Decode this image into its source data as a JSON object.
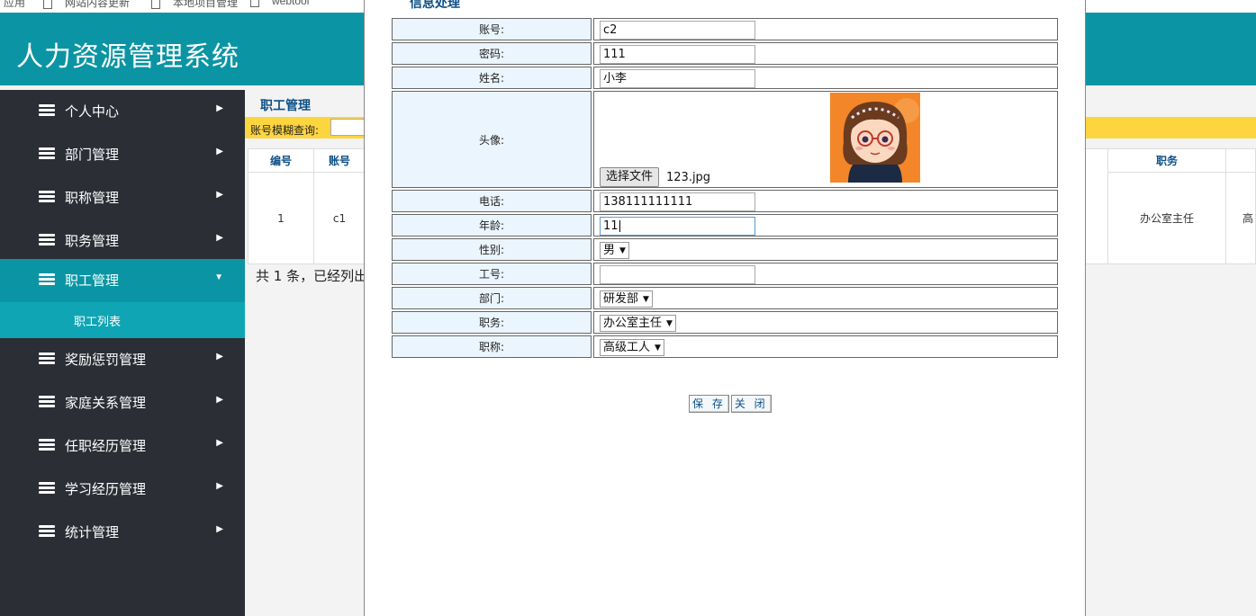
{
  "bookmarks": [
    "应用",
    "网站内容更新",
    "本地项目管理",
    "webtool"
  ],
  "app": {
    "title": "人力资源管理系统"
  },
  "sidebar": {
    "items": [
      {
        "label": "个人中心"
      },
      {
        "label": "部门管理"
      },
      {
        "label": "职称管理"
      },
      {
        "label": "职务管理"
      },
      {
        "label": "职工管理"
      },
      {
        "label": "奖励惩罚管理"
      },
      {
        "label": "家庭关系管理"
      },
      {
        "label": "任职经历管理"
      },
      {
        "label": "学习经历管理"
      },
      {
        "label": "统计管理"
      }
    ],
    "active_sub": "职工列表",
    "arrow_right": "▶",
    "arrow_down": "▼"
  },
  "main": {
    "title": "职工管理",
    "search_label": "账号模糊查询:",
    "table": {
      "headers": [
        "编号",
        "账号",
        "职务"
      ],
      "row": [
        "1",
        "c1",
        "办公室主任",
        "高"
      ]
    },
    "count_text": "共 1 条，已经列出"
  },
  "modal": {
    "title": "信息处理",
    "fields": {
      "account": {
        "label": "账号:",
        "value": "c2"
      },
      "password": {
        "label": "密码:",
        "value": "111"
      },
      "name": {
        "label": "姓名:",
        "value": "小李"
      },
      "avatar": {
        "label": "头像:",
        "file_button": "选择文件",
        "file_name": "123.jpg"
      },
      "phone": {
        "label": "电话:",
        "value": "138111111111"
      },
      "age": {
        "label": "年龄:",
        "value": "11"
      },
      "gender": {
        "label": "性别:",
        "value": "男"
      },
      "employee_no": {
        "label": "工号:",
        "value": ""
      },
      "department": {
        "label": "部门:",
        "value": "研发部"
      },
      "position": {
        "label": "职务:",
        "value": "办公室主任"
      },
      "title": {
        "label": "职称:",
        "value": "高级工人"
      }
    },
    "buttons": {
      "save": "保 存",
      "close": "关 闭"
    }
  },
  "colors": {
    "header": "#0b95a4",
    "sidebar": "#2b2e35",
    "accent_yellow": "#fdd53f",
    "label_cell": "#eaf5fd"
  }
}
